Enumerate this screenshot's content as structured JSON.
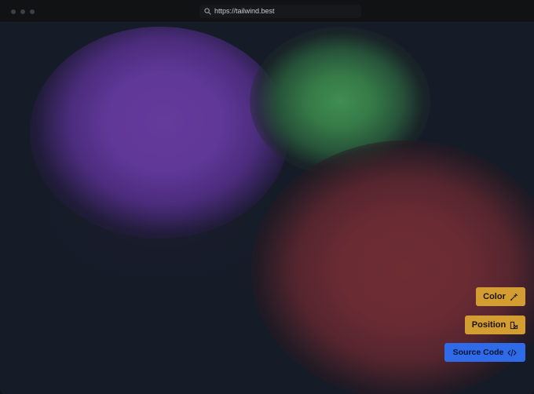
{
  "browser": {
    "url": "https://tailwind.best"
  },
  "canvas": {
    "blobs": [
      {
        "name": "purple",
        "color": "#643a9b"
      },
      {
        "name": "green",
        "color": "#3f8e52"
      },
      {
        "name": "red",
        "color": "#6e2c33"
      }
    ]
  },
  "controls": {
    "color_label": "Color",
    "color_icon": "eyedropper-icon",
    "position_label": "Position",
    "position_icon": "shapes-icon",
    "source_label": "Source Code",
    "source_icon": "code-icon"
  },
  "colors": {
    "accent_yellow": "#d39d32",
    "accent_blue": "#2f6ae8",
    "background": "#161b28"
  }
}
